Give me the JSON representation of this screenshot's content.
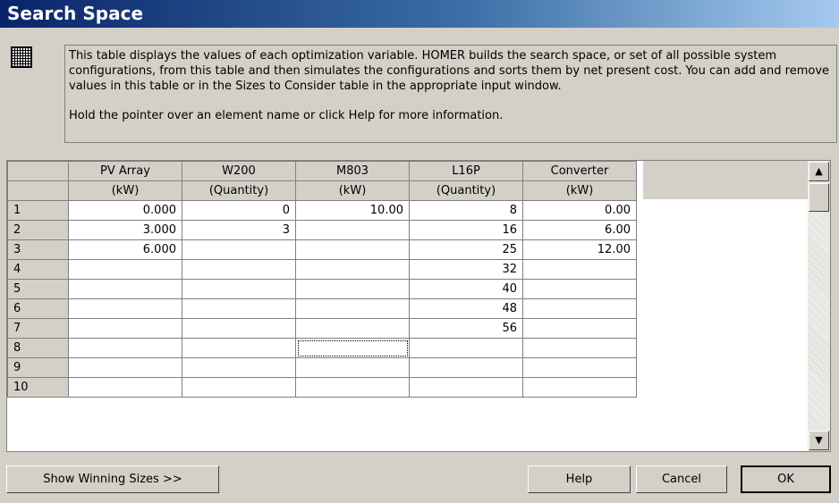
{
  "window": {
    "title": "Search Space"
  },
  "info": {
    "description": "This table displays the values of each optimization variable. HOMER builds the search space, or set of all possible system configurations, from this table and then simulates the configurations and sorts them by net present cost. You can add and remove values in this table or in the Sizes to Consider table in the appropriate input window.",
    "hint": "Hold the pointer over an element name or click Help for more information."
  },
  "grid": {
    "columns": [
      {
        "name": "PV Array",
        "unit": "(kW)"
      },
      {
        "name": "W200",
        "unit": "(Quantity)"
      },
      {
        "name": "M803",
        "unit": "(kW)"
      },
      {
        "name": "L16P",
        "unit": "(Quantity)"
      },
      {
        "name": "Converter",
        "unit": "(kW)"
      }
    ],
    "rows": [
      {
        "num": "1",
        "cells": [
          "0.000",
          "0",
          "10.00",
          "8",
          "0.00"
        ]
      },
      {
        "num": "2",
        "cells": [
          "3.000",
          "3",
          "",
          "16",
          "6.00"
        ]
      },
      {
        "num": "3",
        "cells": [
          "6.000",
          "",
          "",
          "25",
          "12.00"
        ]
      },
      {
        "num": "4",
        "cells": [
          "",
          "",
          "",
          "32",
          ""
        ]
      },
      {
        "num": "5",
        "cells": [
          "",
          "",
          "",
          "40",
          ""
        ]
      },
      {
        "num": "6",
        "cells": [
          "",
          "",
          "",
          "48",
          ""
        ]
      },
      {
        "num": "7",
        "cells": [
          "",
          "",
          "",
          "56",
          ""
        ]
      },
      {
        "num": "8",
        "cells": [
          "",
          "",
          "",
          "",
          ""
        ]
      },
      {
        "num": "9",
        "cells": [
          "",
          "",
          "",
          "",
          ""
        ]
      },
      {
        "num": "10",
        "cells": [
          "",
          "",
          "",
          "",
          ""
        ]
      }
    ]
  },
  "scrollbar": {
    "up_icon": "▲",
    "down_icon": "▼"
  },
  "buttons": {
    "show_winning": "Show Winning Sizes >>",
    "help": "Help",
    "cancel": "Cancel",
    "ok": "OK"
  }
}
